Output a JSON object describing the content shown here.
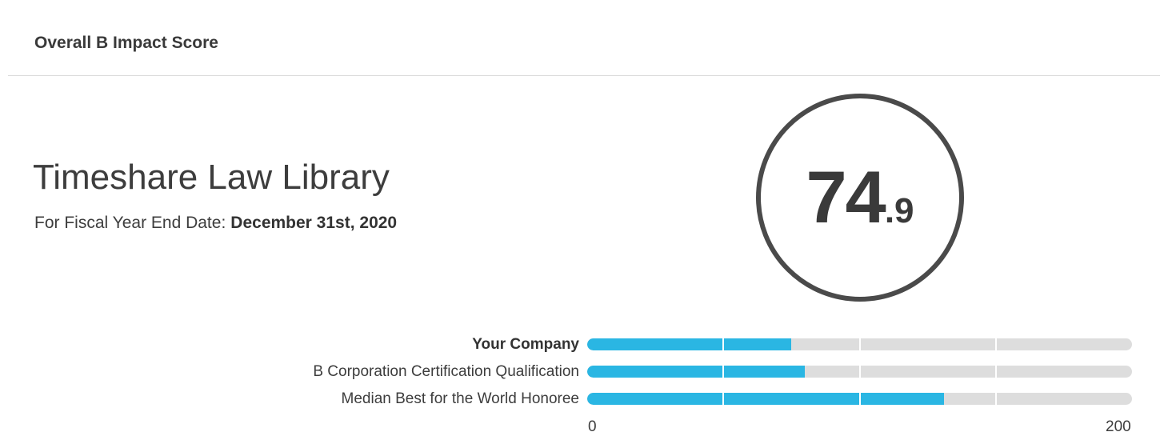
{
  "header": {
    "title": "Overall B Impact Score"
  },
  "company": {
    "name": "Timeshare Law Library",
    "fiscal_label": "For Fiscal Year End Date:",
    "fiscal_date": "December 31st, 2020"
  },
  "score": {
    "integer": "74",
    "decimal": ".9",
    "value": 74.9
  },
  "comparison": {
    "max": 200,
    "min": 0,
    "ticks": [
      50,
      100,
      150
    ],
    "rows": [
      {
        "label": "Your Company",
        "value": 74.9,
        "bold": true
      },
      {
        "label": "B Corporation Certification Qualification",
        "value": 80,
        "bold": false
      },
      {
        "label": "Median Best for the World Honoree",
        "value": 131,
        "bold": false
      }
    ],
    "axis_min_label": "0",
    "axis_max_label": "200"
  },
  "colors": {
    "bar_fill": "#2ab6e3",
    "bar_track": "#dddddd",
    "circle_border": "#4a4a4a"
  }
}
